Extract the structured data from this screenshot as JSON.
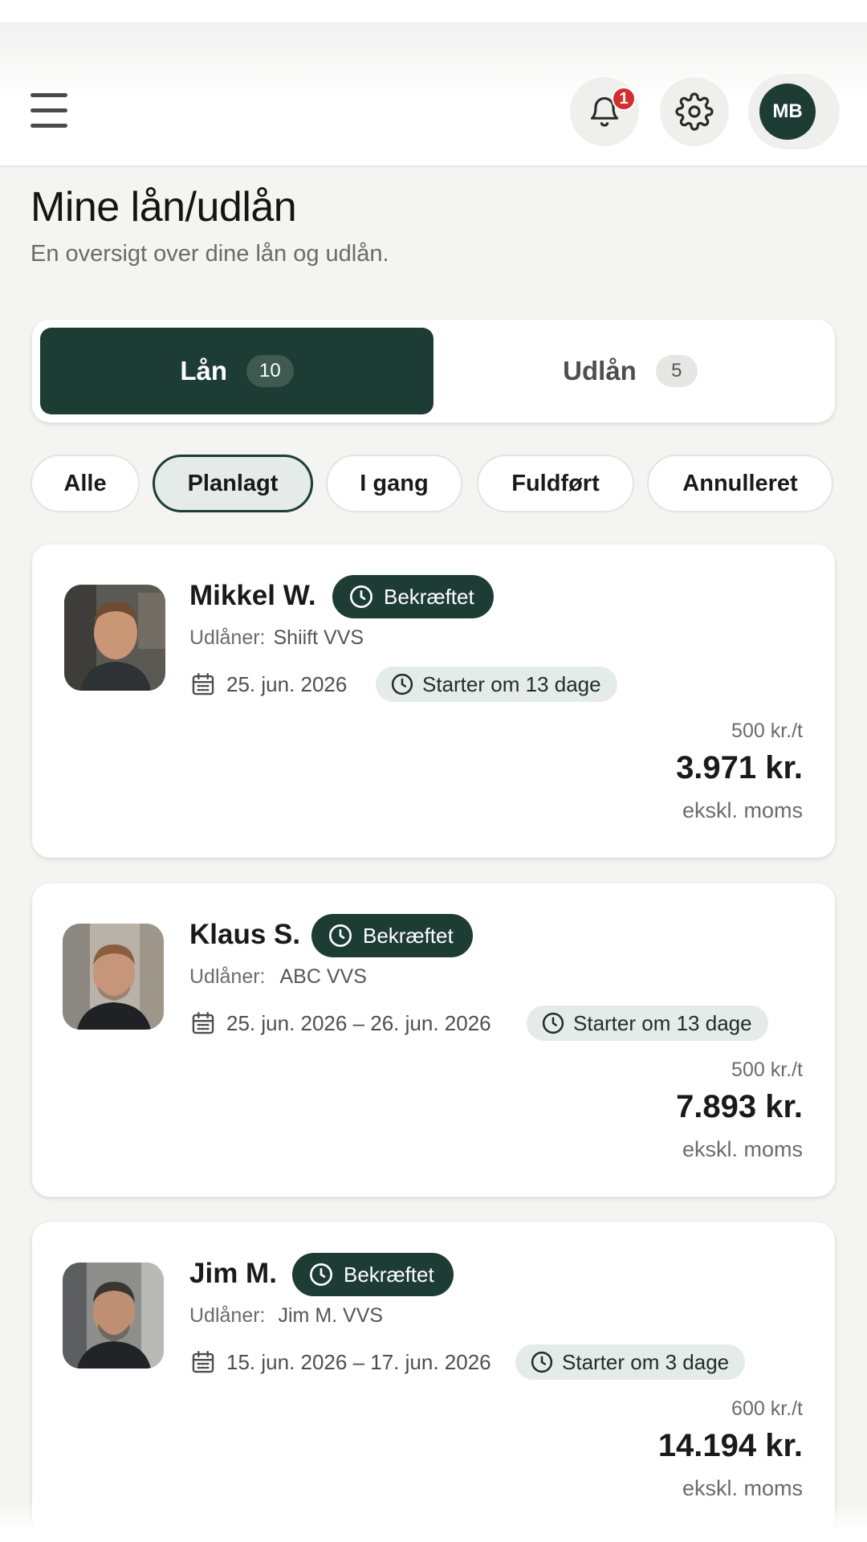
{
  "header": {
    "menu_icon": "hamburger-menu-icon",
    "notifications": {
      "icon": "bell-icon",
      "count": "1"
    },
    "settings_icon": "gear-icon",
    "avatar_initials": "MB"
  },
  "page": {
    "title": "Mine lån/udlån",
    "subtitle": "En oversigt over dine lån og udlån."
  },
  "segments": [
    {
      "label": "Lån",
      "count": "10",
      "active": true
    },
    {
      "label": "Udlån",
      "count": "5",
      "active": false
    }
  ],
  "filters": [
    {
      "label": "Alle",
      "selected": false
    },
    {
      "label": "Planlagt",
      "selected": true
    },
    {
      "label": "I gang",
      "selected": false
    },
    {
      "label": "Fuldført",
      "selected": false
    },
    {
      "label": "Annulleret",
      "selected": false
    }
  ],
  "lender_label": "Udlåner:",
  "loans": [
    {
      "name": "Mikkel W.",
      "status": "Bekræftet",
      "lender": "Shiift VVS",
      "date": "25. jun. 2026",
      "start": "Starter om 13 dage",
      "rate": "500 kr./t",
      "price": "3.971 kr.",
      "vat": "ekskl. moms"
    },
    {
      "name": "Klaus S.",
      "status": "Bekræftet",
      "lender": "ABC VVS",
      "date": "25. jun. 2026 – 26. jun. 2026",
      "start": "Starter om 13 dage",
      "rate": "500 kr./t",
      "price": "7.893 kr.",
      "vat": "ekskl. moms"
    },
    {
      "name": "Jim M.",
      "status": "Bekræftet",
      "lender": "Jim M. VVS",
      "date": "15. jun. 2026 – 17. jun. 2026",
      "start": "Starter om 3 dage",
      "rate": "600 kr./t",
      "price": "14.194 kr.",
      "vat": "ekskl. moms"
    }
  ],
  "colors": {
    "brand": "#1d3d34",
    "chip_selected_bg": "#e4ebe8",
    "notification_badge": "#d32f2f"
  }
}
